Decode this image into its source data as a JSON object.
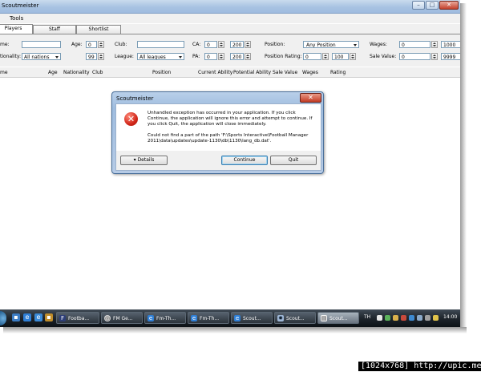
{
  "window": {
    "title": "Scoutmeister",
    "minimize_icon": "minimize-icon",
    "maximize_icon": "maximize-icon",
    "close_icon": "close-icon"
  },
  "menu": {
    "tools": "Tools"
  },
  "tabs": [
    {
      "label": "Players",
      "active": true
    },
    {
      "label": "Staff",
      "active": false
    },
    {
      "label": "Shortlist",
      "active": false
    }
  ],
  "filters": {
    "name_label": "me:",
    "nationality_label": "tionality:",
    "nationality_value": "All nations",
    "age_label": "Age:",
    "age_min": "0",
    "age_max": "99",
    "club_label": "Club:",
    "club_value": "",
    "league_label": "League:",
    "league_value": "All leagues",
    "ca_label": "CA:",
    "ca_min": "0",
    "ca_max": "200",
    "pa_label": "PA:",
    "pa_min": "0",
    "pa_max": "200",
    "position_label": "Position:",
    "position_value": "Any Position",
    "position_rating_label": "Position Rating:",
    "position_rating_min": "0",
    "position_rating_max": "100",
    "wages_label": "Wages:",
    "wages_min": "0",
    "wages_max": "1000",
    "sale_value_label": "Sale Value:",
    "sale_value_min": "0",
    "sale_value_max": "9999"
  },
  "columns": [
    "me",
    "Age",
    "Nationality",
    "Club",
    "Position",
    "Current Ability",
    "Potential Ability",
    "Sale Value",
    "Wages",
    "Rating"
  ],
  "dialog": {
    "title": "Scoutmeister",
    "icon": "error-icon",
    "message_lines": [
      "Unhandled exception has occurred in your application. If you click",
      "Continue, the application will ignore this error and attempt to continue. If",
      "you click Quit, the application will close immediately.",
      "Could not find a part of the path 'F:\\Sports Interactive\\Football Manager",
      "2011\\data\\updates\\update-1130\\db\\1130\\lang_db.dat'."
    ],
    "details_button": "Details",
    "continue_button": "Continue",
    "quit_button": "Quit"
  },
  "taskbar": {
    "tasks": [
      {
        "label": "Footba...",
        "icon": "fm-icon",
        "active": false
      },
      {
        "label": "FM Ge...",
        "icon": "chrome-icon",
        "active": false
      },
      {
        "label": "Fm-Th...",
        "icon": "ie-icon",
        "active": false
      },
      {
        "label": "Fm-Th...",
        "icon": "ie-icon",
        "active": false
      },
      {
        "label": "Scout...",
        "icon": "ie-icon",
        "active": false
      },
      {
        "label": "Scout...",
        "icon": "app-icon",
        "active": false
      },
      {
        "label": "Scout...",
        "icon": "window-icon",
        "active": true
      }
    ],
    "language": "TH",
    "clock": "14:00"
  },
  "watermark": "[1024x768] http://upic.me/",
  "colors": {
    "titlebar": "#a8c3e2",
    "taskbar": "#1e252c",
    "error_red": "#d2271a",
    "window_bg": "#f0f0f0"
  }
}
